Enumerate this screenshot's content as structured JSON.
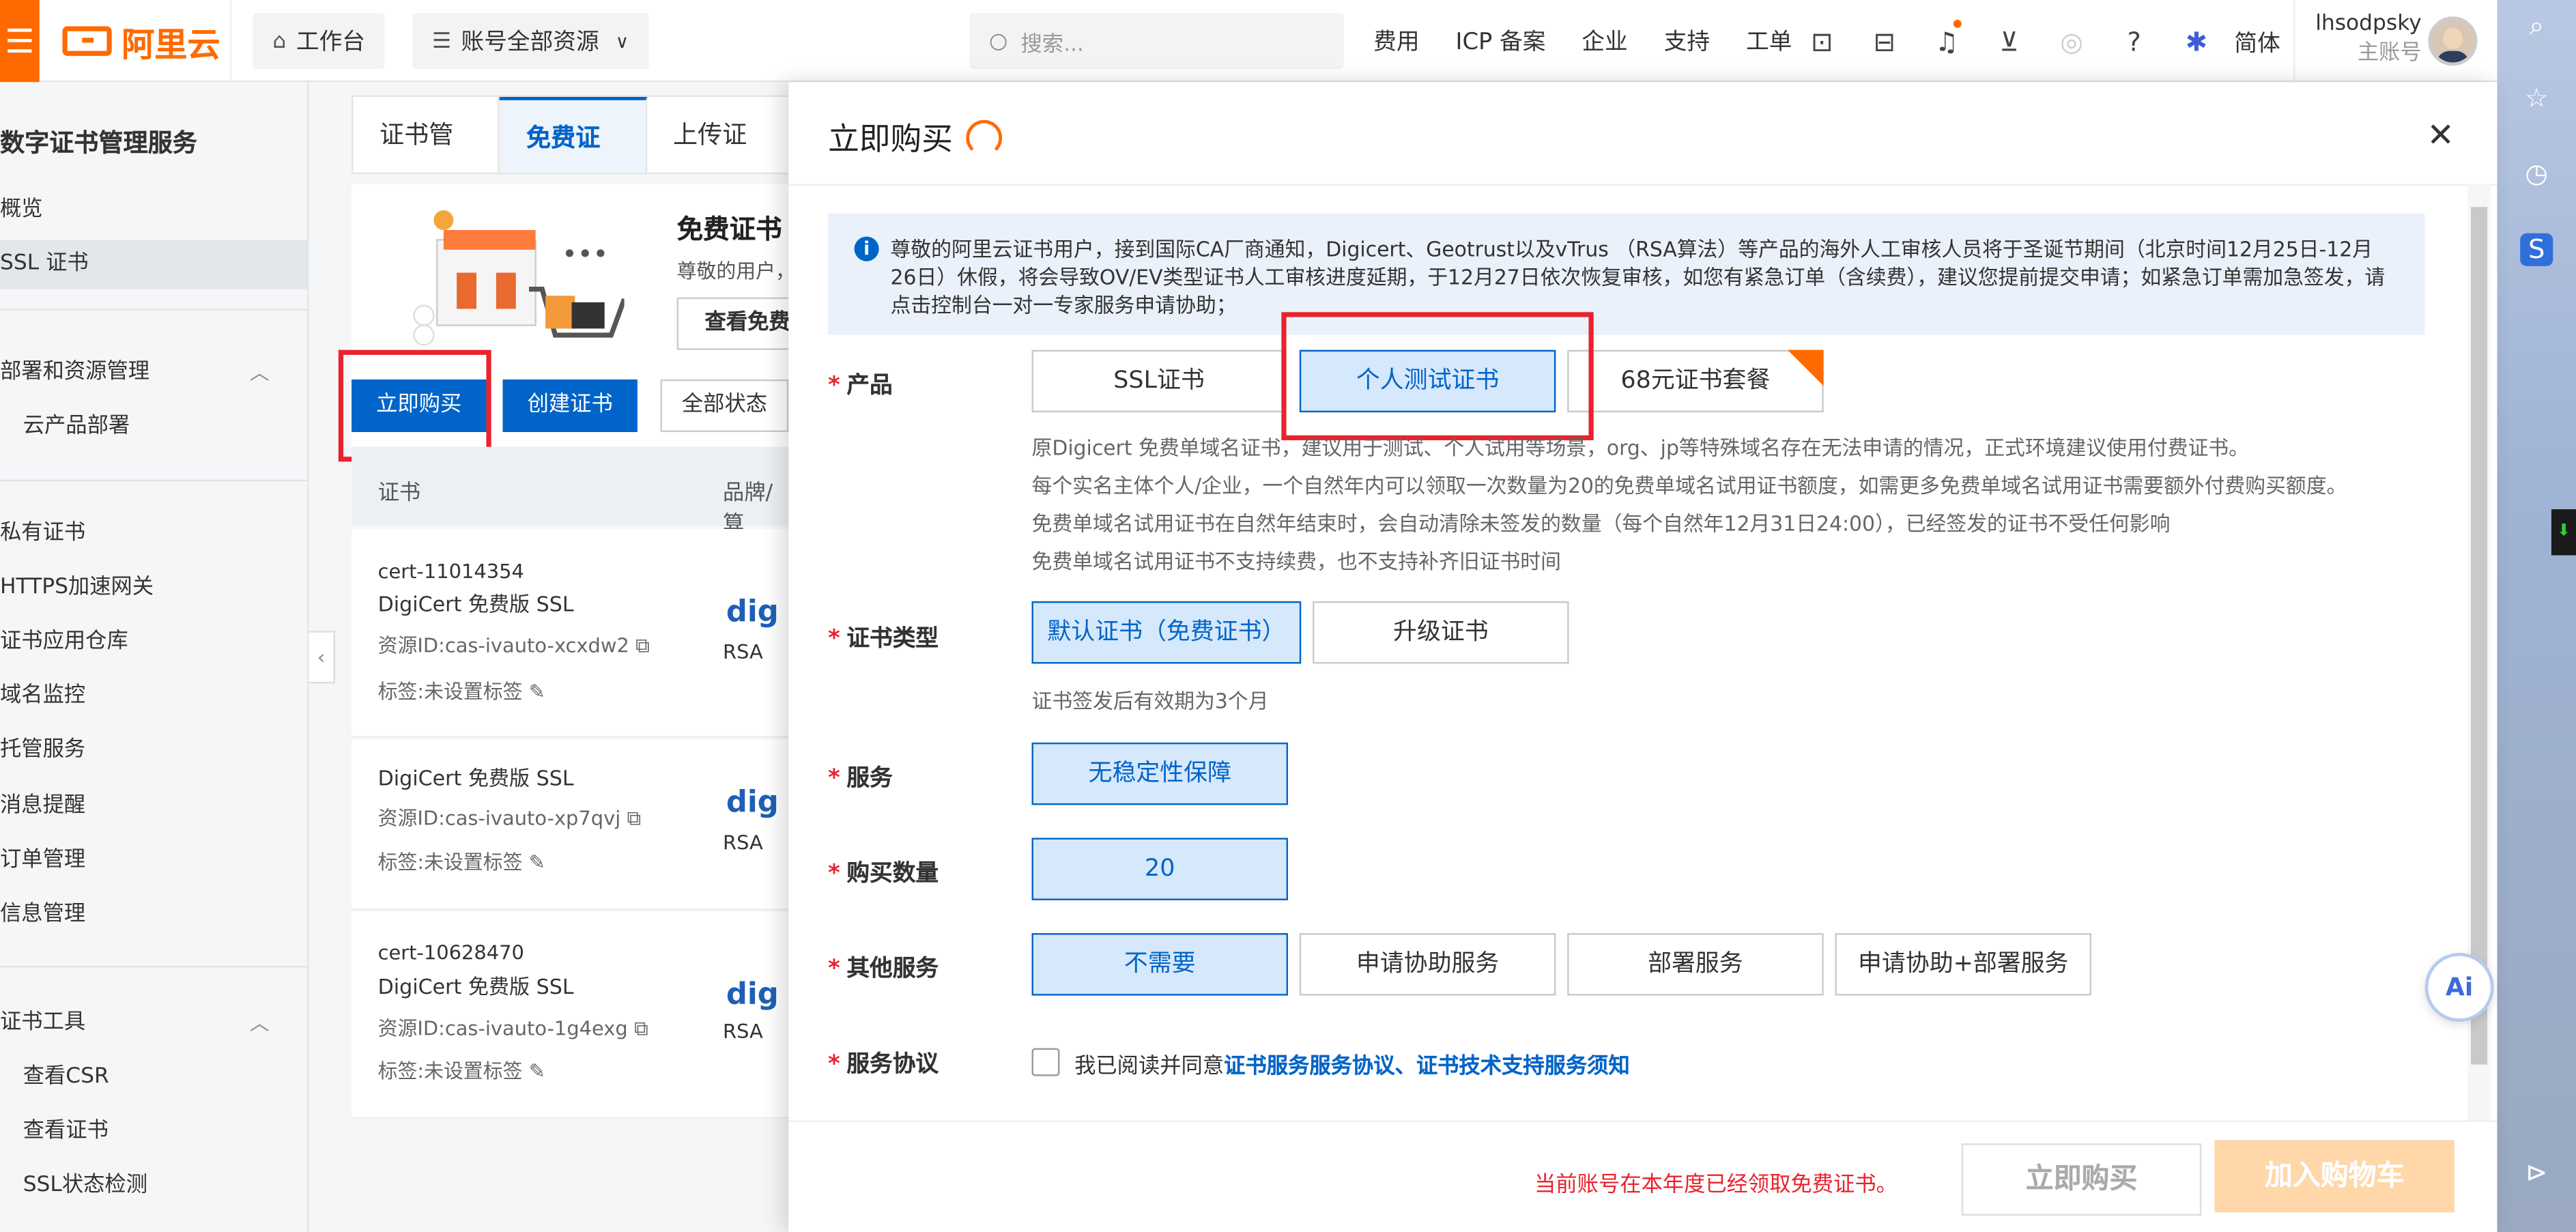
{
  "topbar": {
    "logo": "阿里云",
    "workbench": "工作台",
    "resource_selector": "账号全部资源",
    "search_placeholder": "搜索...",
    "nav": [
      "费用",
      "ICP 备案",
      "企业",
      "支持",
      "工单"
    ],
    "lang": "简体",
    "username": "lhsodpsky",
    "account_type": "主账号"
  },
  "sidebar": {
    "title": "数字证书管理服务",
    "items": [
      "概览",
      "SSL 证书"
    ],
    "group1": "部署和资源管理",
    "group1_items": [
      "云产品部署"
    ],
    "items2": [
      "私有证书",
      "HTTPS加速网关",
      "证书应用仓库",
      "域名监控",
      "托管服务",
      "消息提醒",
      "订单管理",
      "信息管理"
    ],
    "group2": "证书工具",
    "group2_items": [
      "查看CSR",
      "查看证书",
      "SSL状态检测"
    ]
  },
  "content": {
    "tabs": [
      "证书管理",
      "免费证书",
      "上传证书"
    ],
    "free_title": "免费证书",
    "free_sub": "尊敬的用户，",
    "view_free": "查看免费",
    "buy_now": "立即购买",
    "create_cert": "创建证书",
    "status_filter": "全部状态",
    "col_cert": "证书",
    "col_brand": "品牌/算",
    "rows": [
      {
        "id": "cert-11014354",
        "name": "DigiCert 免费版 SSL",
        "resource": "资源ID:cas-ivauto-xcxdw2",
        "tag": "标签:未设置标签",
        "algo": "RSA"
      },
      {
        "id": "",
        "name": "DigiCert 免费版 SSL",
        "resource": "资源ID:cas-ivauto-xp7qvj",
        "tag": "标签:未设置标签",
        "algo": "RSA"
      },
      {
        "id": "cert-10628470",
        "name": "DigiCert 免费版 SSL",
        "resource": "资源ID:cas-ivauto-1g4exg",
        "tag": "标签:未设置标签",
        "algo": "RSA"
      }
    ],
    "brand_short": "dig"
  },
  "drawer": {
    "title": "立即购买",
    "notice": "尊敬的阿里云证书用户，接到国际CA厂商通知，Digicert、Geotrust以及vTrus （RSA算法）等产品的海外人工审核人员将于圣诞节期间（北京时间12月25日-12月26日）休假，将会导致OV/EV类型证书人工审核进度延期，于12月27日依次恢复审核，如您有紧急订单（含续费），建议您提前提交申请；如紧急订单需加急签发，请点击控制台一对一专家服务申请协助；",
    "product_label": "产品",
    "product_options": [
      "SSL证书",
      "个人测试证书",
      "68元证书套餐"
    ],
    "product_hints": [
      "原Digicert 免费单域名证书，建议用于测试、个人试用等场景，org、jp等特殊域名存在无法申请的情况，正式环境建议使用付费证书。",
      "每个实名主体个人/企业，一个自然年内可以领取一次数量为20的免费单域名试用证书额度，如需更多免费单域名试用证书需要额外付费购买额度。",
      "免费单域名试用证书在自然年结束时，会自动清除未签发的数量（每个自然年12月31日24:00），已经签发的证书不受任何影响",
      "免费单域名试用证书不支持续费，也不支持补齐旧证书时间"
    ],
    "cert_type_label": "证书类型",
    "cert_type_options": [
      "默认证书（免费证书）",
      "升级证书"
    ],
    "cert_type_hint": "证书签发后有效期为3个月",
    "service_label": "服务",
    "service_value": "无稳定性保障",
    "quantity_label": "购买数量",
    "quantity_value": "20",
    "other_label": "其他服务",
    "other_options": [
      "不需要",
      "申请协助服务",
      "部署服务",
      "申请协助+部署服务"
    ],
    "agreement_label": "服务协议",
    "agreement_prefix": "我已阅读并同意",
    "agreement_link1": "证书服务服务协议",
    "agreement_sep": "、",
    "agreement_link2": "证书技术支持服务须知",
    "warning": "当前账号在本年度已经领取免费证书。",
    "buy_button": "立即购买",
    "cart_button": "加入购物车"
  },
  "colors": {
    "brand": "#ff6a00",
    "primary": "#0064c8",
    "highlight": "#e8232d"
  }
}
